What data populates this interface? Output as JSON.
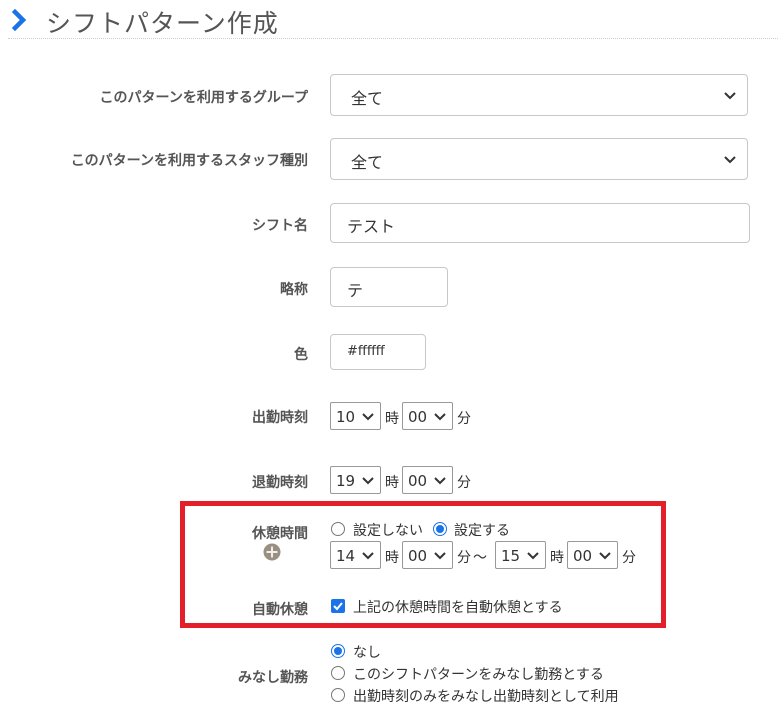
{
  "header": {
    "title": "シフトパターン作成",
    "icon": "chevron-right-icon",
    "accent": "#1a73e8"
  },
  "form": {
    "group": {
      "label": "このパターンを利用するグループ",
      "value": "全て"
    },
    "staff_type": {
      "label": "このパターンを利用するスタッフ種別",
      "value": "全て"
    },
    "shift_name": {
      "label": "シフト名",
      "value": "テスト"
    },
    "abbrev": {
      "label": "略称",
      "value": "テ"
    },
    "color": {
      "label": "色",
      "value": "#ffffff"
    },
    "start_time": {
      "label": "出勤時刻",
      "hour": "10",
      "hour_unit": "時",
      "minute": "00",
      "minute_unit": "分"
    },
    "end_time": {
      "label": "退勤時刻",
      "hour": "19",
      "hour_unit": "時",
      "minute": "00",
      "minute_unit": "分"
    },
    "break": {
      "label": "休憩時間",
      "option_none": "設定しない",
      "option_set": "設定する",
      "selected": "設定する",
      "from_hour": "14",
      "from_minute": "00",
      "to_hour": "15",
      "to_minute": "00",
      "hour_unit": "時",
      "minute_unit": "分",
      "range_sep": "〜"
    },
    "auto_break": {
      "label": "自動休憩",
      "checkbox_label": "上記の休憩時間を自動休憩とする",
      "checked": true
    },
    "deemed": {
      "label": "みなし勤務",
      "options": [
        "なし",
        "このシフトパターンをみなし勤務とする",
        "出勤時刻のみをみなし出勤時刻として利用"
      ],
      "selected": "なし"
    }
  },
  "highlight_color": "#e3202a"
}
